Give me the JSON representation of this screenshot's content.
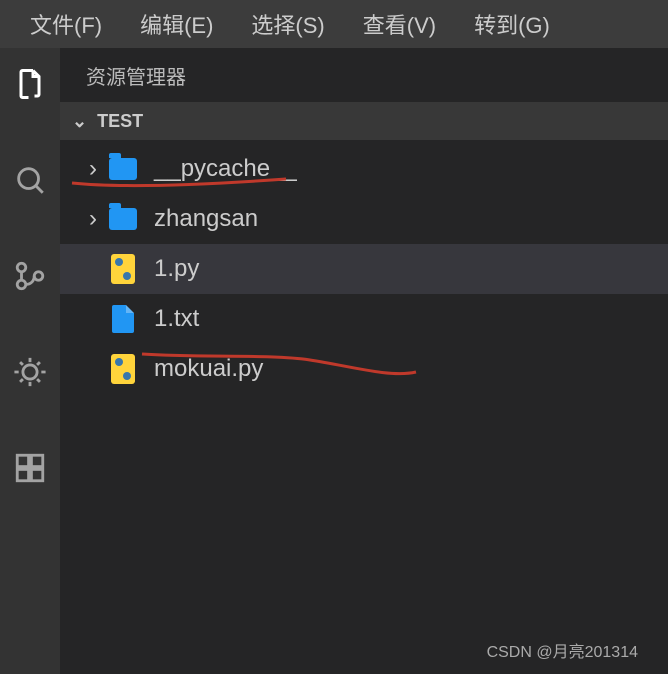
{
  "menubar": {
    "file": "文件(F)",
    "edit": "编辑(E)",
    "select": "选择(S)",
    "view": "查看(V)",
    "goto": "转到(G)"
  },
  "sidebar": {
    "title": "资源管理器",
    "section": "TEST"
  },
  "tree": {
    "items": [
      {
        "kind": "folder",
        "label": "__pycache__",
        "chev": "›"
      },
      {
        "kind": "folder",
        "label": "zhangsan",
        "chev": "›"
      },
      {
        "kind": "py",
        "label": "1.py",
        "selected": true
      },
      {
        "kind": "txt",
        "label": "1.txt"
      },
      {
        "kind": "py",
        "label": "mokuai.py"
      }
    ]
  },
  "watermark": "CSDN @月亮201314"
}
